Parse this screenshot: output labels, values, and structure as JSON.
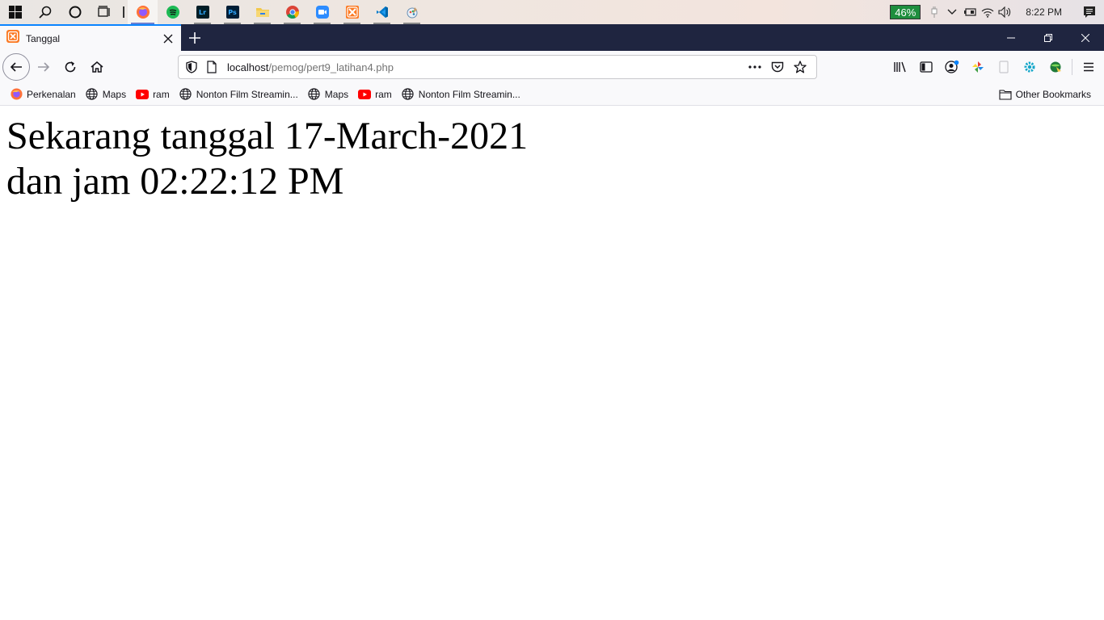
{
  "taskbar": {
    "apps": [
      {
        "icon": "windows-start-icon"
      },
      {
        "icon": "search-icon"
      },
      {
        "icon": "cortana-icon"
      },
      {
        "icon": "task-view-icon"
      },
      {
        "icon": "firefox-icon",
        "active": true
      },
      {
        "icon": "spotify-icon"
      },
      {
        "icon": "lightroom-icon",
        "label": "Lr"
      },
      {
        "icon": "photoshop-icon",
        "label": "Ps"
      },
      {
        "icon": "file-explorer-icon"
      },
      {
        "icon": "chrome-icon"
      },
      {
        "icon": "zoom-icon"
      },
      {
        "icon": "xampp-icon"
      },
      {
        "icon": "vscode-icon"
      },
      {
        "icon": "paint-icon"
      }
    ],
    "battery": "46%",
    "clock": "8:22 PM"
  },
  "tab": {
    "title": "Tanggal"
  },
  "urlbar": {
    "host": "localhost",
    "path": "/pemog/pert9_latihan4.php"
  },
  "bookmarks": {
    "items": [
      {
        "label": "Perkenalan",
        "icon": "firefox-icon"
      },
      {
        "label": "Maps",
        "icon": "globe-icon"
      },
      {
        "label": "ram",
        "icon": "youtube-icon"
      },
      {
        "label": "Nonton Film Streamin...",
        "icon": "globe-icon"
      },
      {
        "label": "Maps",
        "icon": "globe-icon"
      },
      {
        "label": "ram",
        "icon": "youtube-icon"
      },
      {
        "label": "Nonton Film Streamin...",
        "icon": "globe-icon"
      }
    ],
    "other": "Other Bookmarks"
  },
  "page": {
    "line1": "Sekarang tanggal 17-March-2021",
    "line2": "dan jam 02:22:12 PM"
  },
  "colors": {
    "tabstrip": "#1f2540",
    "toolbar": "#f9f9fb",
    "battery": "#1e8e3e"
  }
}
